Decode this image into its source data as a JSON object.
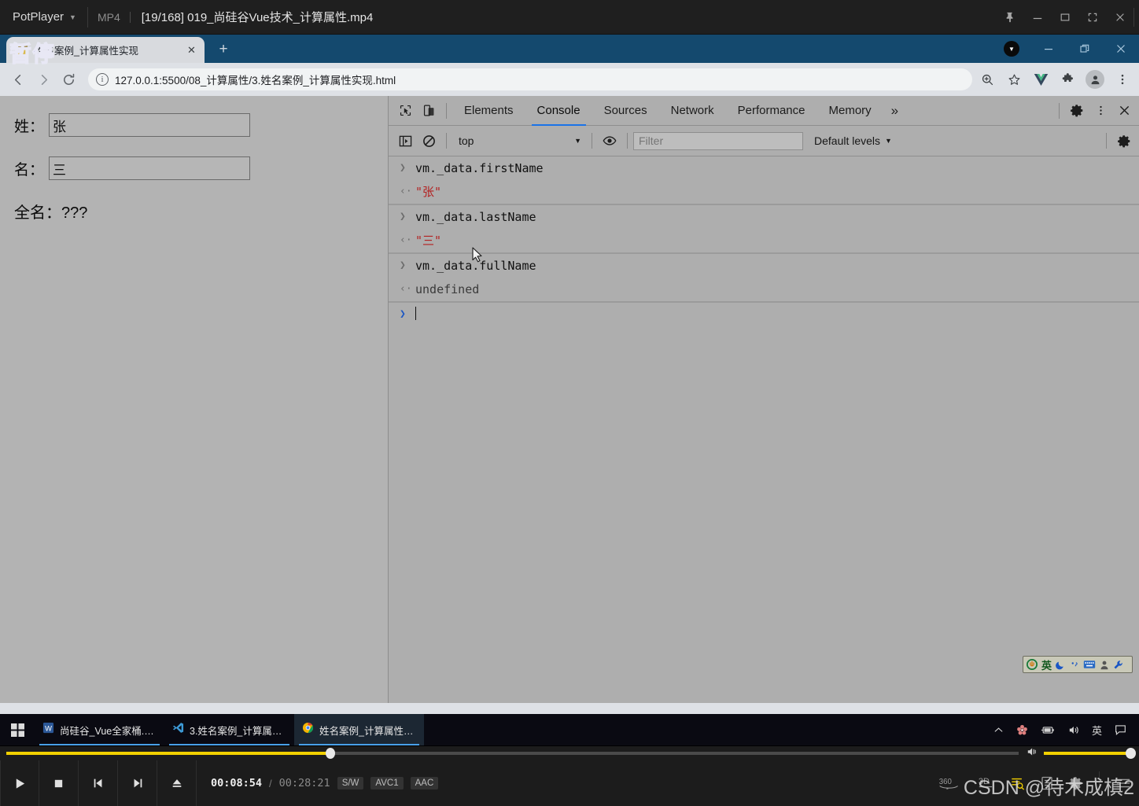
{
  "potplayer": {
    "brand": "PotPlayer",
    "format": "MP4",
    "title": "[19/168] 019_尚硅谷Vue技术_计算属性.mp4",
    "osd_text": "暂停",
    "window_buttons": [
      "pin-icon",
      "minimize-icon",
      "maximize-icon",
      "fullscreen-icon",
      "close-icon"
    ],
    "controls": {
      "play_label": "play-icon",
      "stop_label": "stop-icon",
      "prev_label": "previous-icon",
      "next_label": "next-icon",
      "eject_label": "eject-icon",
      "current_time": "00:08:54",
      "separator": "/",
      "total_time": "00:28:21",
      "badges": [
        "S/W",
        "AVC1",
        "AAC"
      ],
      "right_icons": [
        "360",
        "3D",
        "search-icon",
        "playlist-icon",
        "gear-icon",
        "menu-icon"
      ],
      "seek_percent": 32,
      "volume_percent": 100
    },
    "watermark": "CSDN @待木成槙2"
  },
  "chrome": {
    "tab": {
      "title": "姓名案例_计算属性实现",
      "close_label": "✕",
      "favicon": "vue-page-favicon"
    },
    "new_tab_label": "+",
    "window_buttons": [
      "download-indicator",
      "minimize-icon",
      "restore-icon",
      "close-icon"
    ],
    "toolbar": {
      "back_label": "back-arrow-icon",
      "forward_label": "forward-arrow-icon",
      "reload_label": "reload-icon",
      "site_info_label": "ⓘ",
      "url": "127.0.0.1:5500/08_计算属性/3.姓名案例_计算属性实现.html",
      "right_icons": [
        "zoom-icon",
        "bookmark-star-icon",
        "vue-devtools-icon",
        "extensions-puzzle-icon",
        "profile-avatar",
        "chrome-menu-icon"
      ]
    }
  },
  "page": {
    "fields": [
      {
        "label": "姓：",
        "value": "张",
        "name": "first-name"
      },
      {
        "label": "名：",
        "value": "三",
        "name": "last-name"
      }
    ],
    "fullname_text": "全名：???"
  },
  "devtools": {
    "left_icons": [
      "inspect-element-icon",
      "device-toolbar-icon"
    ],
    "tabs": [
      {
        "label": "Elements",
        "active": false
      },
      {
        "label": "Console",
        "active": true
      },
      {
        "label": "Sources",
        "active": false
      },
      {
        "label": "Network",
        "active": false
      },
      {
        "label": "Performance",
        "active": false
      },
      {
        "label": "Memory",
        "active": false
      }
    ],
    "more_tabs_label": "»",
    "right_icons": [
      "settings-gear-icon",
      "more-options-icon",
      "close-devtools-icon"
    ],
    "console_toolbar": {
      "sidebar_toggle": "console-sidebar-icon",
      "clear_label": "clear-console-icon",
      "context": "top",
      "context_caret": "▼",
      "eye_label": "live-expression-eye-icon",
      "filter_placeholder": "Filter",
      "filter_value": "",
      "levels_label": "Default levels",
      "levels_caret": "▼",
      "settings_label": "console-settings-icon"
    },
    "console_entries": [
      {
        "kind": "input",
        "arrow": "❯",
        "text": "vm._data.firstName"
      },
      {
        "kind": "output",
        "arrow": "‹·",
        "text": "\"张\"",
        "style": "string"
      },
      {
        "kind": "input",
        "arrow": "❯",
        "text": "vm._data.lastName"
      },
      {
        "kind": "output",
        "arrow": "‹·",
        "text": "\"三\"",
        "style": "string"
      },
      {
        "kind": "input",
        "arrow": "❯",
        "text": "vm._data.fullName"
      },
      {
        "kind": "output",
        "arrow": "‹·",
        "text": "undefined",
        "style": "undefined"
      }
    ],
    "prompt_arrow": "❯",
    "prompt_value": ""
  },
  "ime": {
    "items": [
      "sogou-logo-icon",
      "英",
      "moon-icon",
      "punctuation-icon",
      "keyboard-icon",
      "user-icon",
      "wrench-icon"
    ]
  },
  "taskbar": {
    "start_label": "windows-start-icon",
    "items": [
      {
        "label": "尚硅谷_Vue全家桶.d...",
        "icon": "word-icon",
        "active": false
      },
      {
        "label": "3.姓名案例_计算属性...",
        "icon": "vscode-icon",
        "active": false
      },
      {
        "label": "姓名案例_计算属性实...",
        "icon": "chrome-icon",
        "active": true
      }
    ],
    "tray": [
      "chevron-up-icon",
      "sakura-icon",
      "battery-icon",
      "volume-icon",
      "英",
      "notification-icon"
    ]
  },
  "colors": {
    "accent_blue": "#1a73e8",
    "tabstrip_blue": "#14496e",
    "page_gray": "#b3b3b3",
    "devtools_gray": "#aeaeae",
    "console_string_red": "#b32121",
    "potplayer_yellow": "#f2d000",
    "osd_purple": "#4b3fbf"
  }
}
